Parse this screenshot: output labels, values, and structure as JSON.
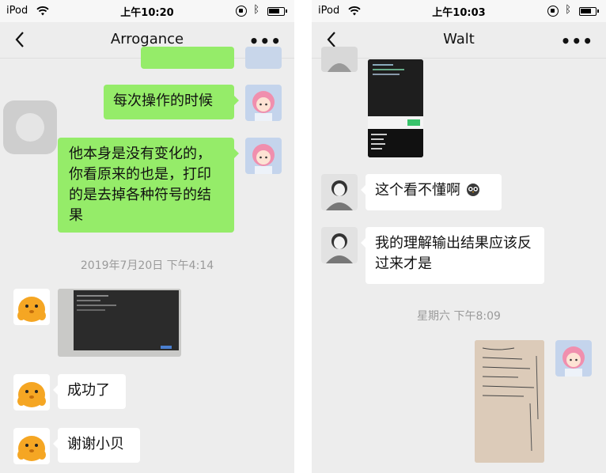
{
  "left": {
    "status": {
      "carrier": "iPod",
      "time": "上午10:20"
    },
    "nav": {
      "title": "Arrogance",
      "more": "•••"
    },
    "messages": {
      "m1": "每次操作的时候",
      "m2": "他本身是没有变化的，你看原来的也是，打印的是去掉各种符号的结果",
      "timestamp": "2019年7月20日 下午4:14",
      "m3": "成功了",
      "m4": "谢谢小贝"
    }
  },
  "right": {
    "status": {
      "carrier": "iPod",
      "time": "上午10:03"
    },
    "nav": {
      "title": "Walt",
      "more": "•••"
    },
    "messages": {
      "m1": "这个看不懂啊",
      "m2": "我的理解输出结果应该反过来才是",
      "timestamp": "星期六 下午8:09"
    }
  },
  "colors": {
    "sent_bubble": "#95ec69",
    "received_bubble": "#ffffff",
    "chat_background": "#ededed"
  },
  "icons": [
    "back-chevron-icon",
    "more-dots-icon",
    "wifi-icon",
    "rotation-lock-icon",
    "bluetooth-icon",
    "battery-icon",
    "owl-emoji-icon"
  ]
}
